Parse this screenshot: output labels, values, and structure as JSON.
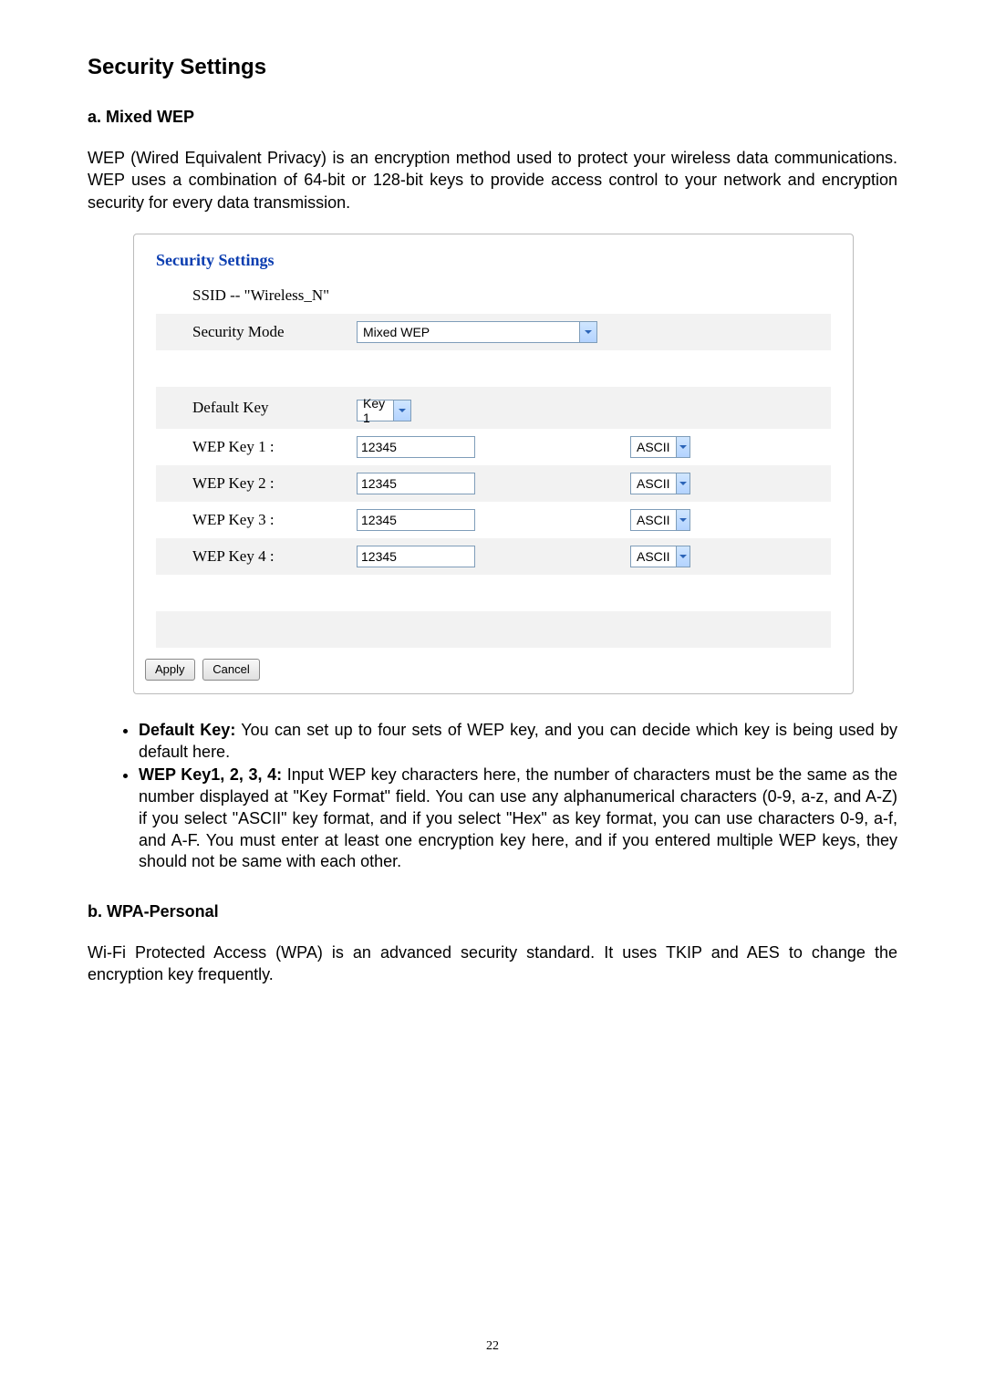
{
  "heading": "Security Settings",
  "section_a": {
    "title": "a. Mixed WEP",
    "intro": "WEP (Wired Equivalent Privacy) is an encryption method used to protect your wireless data communications. WEP uses a combination of 64-bit or 128-bit keys to provide access control to your network and encryption security for every data transmission."
  },
  "screenshot": {
    "panel_title": "Security Settings",
    "ssid_label": "SSID -- \"Wireless_N\"",
    "security_mode_label": "Security Mode",
    "security_mode_value": "Mixed WEP",
    "default_key_label": "Default Key",
    "default_key_value": "Key 1",
    "wep1_label": "WEP Key 1 :",
    "wep2_label": "WEP Key 2 :",
    "wep3_label": "WEP Key 3 :",
    "wep4_label": "WEP Key 4 :",
    "wep1_value": "12345",
    "wep2_value": "12345",
    "wep3_value": "12345",
    "wep4_value": "12345",
    "ascii": "ASCII",
    "apply_label": "Apply",
    "cancel_label": "Cancel"
  },
  "bullets": {
    "default_key_bold": "Default Key:",
    "default_key_text": " You can set up to four sets of WEP key, and you can decide which key is being used by default here.",
    "wep_keys_bold": "WEP Key1, 2, 3, 4:",
    "wep_keys_text": " Input WEP key characters here, the number of characters must be the same as the number displayed at \"Key Format\" field. You can use any alphanumerical characters (0-9, a-z, and A-Z) if you select \"ASCII\" key format, and if you select \"Hex\" as key format, you can use characters 0-9, a-f, and A-F. You must enter at least one encryption key here, and if you entered multiple WEP keys, they should not be same with each other."
  },
  "section_b": {
    "title": "b. WPA-Personal",
    "intro": "Wi-Fi Protected Access (WPA) is an advanced security standard. It uses TKIP and AES to change the encryption key frequently."
  },
  "page_number": "22"
}
